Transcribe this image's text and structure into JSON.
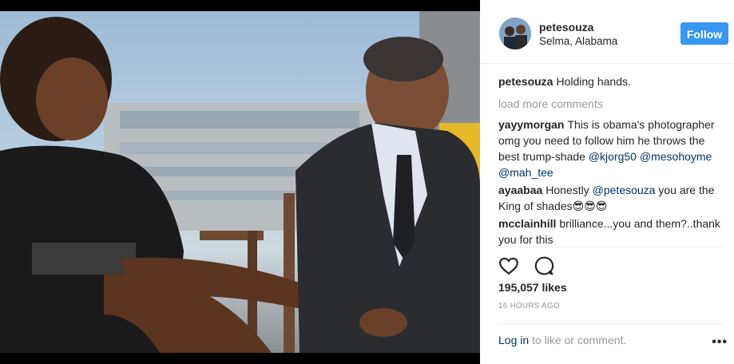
{
  "post": {
    "username": "petesouza",
    "location": "Selma, Alabama",
    "follow_label": "Follow"
  },
  "comments": {
    "caption": {
      "user": "petesouza",
      "text": "Holding hands."
    },
    "load_more": "load more comments",
    "items": [
      {
        "user": "yayymorgan",
        "text": "This is obama's photographer omg you need to follow him he throws the best trump-shade",
        "mentions": [
          "@kjorg50",
          "@mesohoyme",
          "@mah_tee"
        ]
      },
      {
        "user": "ayaabaa",
        "text_before": "Honestly",
        "mention": "@petesouza",
        "text_after": "you are the King of shades😎😎😎"
      },
      {
        "user": "mcclainhill",
        "text": "brilliance...you and them?..thank you for this"
      }
    ]
  },
  "actions": {
    "like_icon": "heart-icon",
    "comment_icon": "comment-bubble-icon"
  },
  "likes": "195,057 likes",
  "time": "16 HOURS AGO",
  "footer": {
    "login": "Log in",
    "rest": "to like or comment.",
    "more": "•••"
  },
  "colors": {
    "follow_blue": "#3897f0",
    "link": "#003569",
    "muted": "#999999",
    "text": "#262626"
  }
}
